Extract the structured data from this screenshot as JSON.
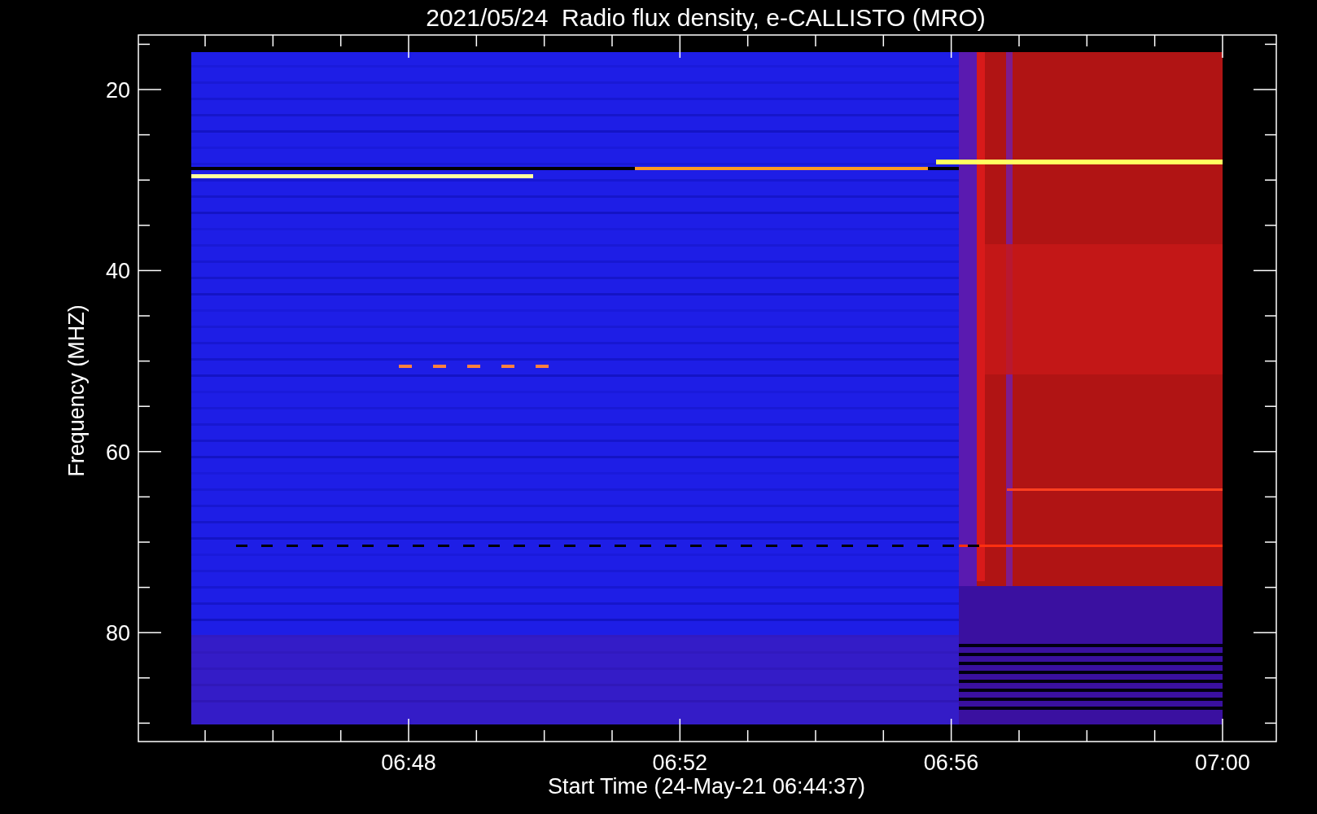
{
  "title": "2021/05/24  Radio flux density, e-CALLISTO (MRO)",
  "y_axis": {
    "label": "Frequency (MHZ)",
    "ticks": [
      "20",
      "40",
      "60",
      "80"
    ]
  },
  "x_axis": {
    "label": "Start Time (24-May-21 06:44:37)",
    "ticks": [
      "06:48",
      "06:52",
      "06:56",
      "07:00"
    ]
  }
}
